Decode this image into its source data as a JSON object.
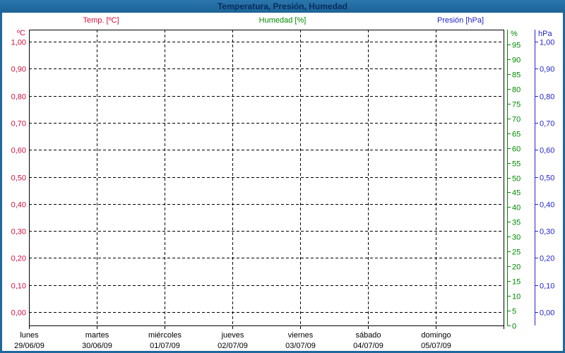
{
  "window": {
    "title": "Temperatura, Presión, Humedad"
  },
  "legend": [
    {
      "label": "Temp. [ºC]",
      "color": "#d1103c"
    },
    {
      "label": "Humedad [%]",
      "color": "#008a00"
    },
    {
      "label": "Presión [hPa]",
      "color": "#2323cb"
    }
  ],
  "chart_data": {
    "type": "line",
    "title": "Temperatura, Presión, Humedad",
    "empty": true,
    "grid": true,
    "frame_color": "#000000",
    "gridline_color": "#000000",
    "series": [
      {
        "name": "Temp. [ºC]",
        "unit": "ºC",
        "color": "#d1103c",
        "values": []
      },
      {
        "name": "Humedad [%]",
        "unit": "%",
        "color": "#008a00",
        "values": []
      },
      {
        "name": "Presión [hPa]",
        "unit": "hPa",
        "color": "#2323cb",
        "values": []
      }
    ],
    "axes": {
      "temp": {
        "unit": "ºC",
        "side": "left",
        "color": "#d1103c",
        "min": 0,
        "max": 1,
        "step": 0.1,
        "tick_labels": [
          "0,00",
          "0,10",
          "0,20",
          "0,30",
          "0,40",
          "0,50",
          "0,60",
          "0,70",
          "0,80",
          "0,90",
          "1,00"
        ]
      },
      "humidity": {
        "unit": "%",
        "side": "right-inner",
        "color": "#008a00",
        "min": 0,
        "max": 100,
        "step": 5,
        "tick_labels": [
          "0",
          "5",
          "10",
          "15",
          "20",
          "25",
          "30",
          "35",
          "40",
          "45",
          "50",
          "55",
          "60",
          "65",
          "70",
          "75",
          "80",
          "85",
          "90",
          "95"
        ]
      },
      "pressure": {
        "unit": "hPa",
        "side": "right-outer",
        "color": "#2323cb",
        "min": 0,
        "max": 1,
        "step": 0.1,
        "tick_labels": [
          "0,00",
          "0,10",
          "0,20",
          "0,30",
          "0,40",
          "0,50",
          "0,60",
          "0,70",
          "0,80",
          "0,90",
          "1,00"
        ]
      },
      "x": {
        "days": [
          {
            "name": "lunes",
            "date": "29/06/09"
          },
          {
            "name": "martes",
            "date": "30/06/09"
          },
          {
            "name": "miércoles",
            "date": "01/07/09"
          },
          {
            "name": "jueves",
            "date": "02/07/09"
          },
          {
            "name": "viernes",
            "date": "03/07/09"
          },
          {
            "name": "sábado",
            "date": "04/07/09"
          },
          {
            "name": "domingo",
            "date": "05/07/09"
          }
        ]
      }
    }
  }
}
